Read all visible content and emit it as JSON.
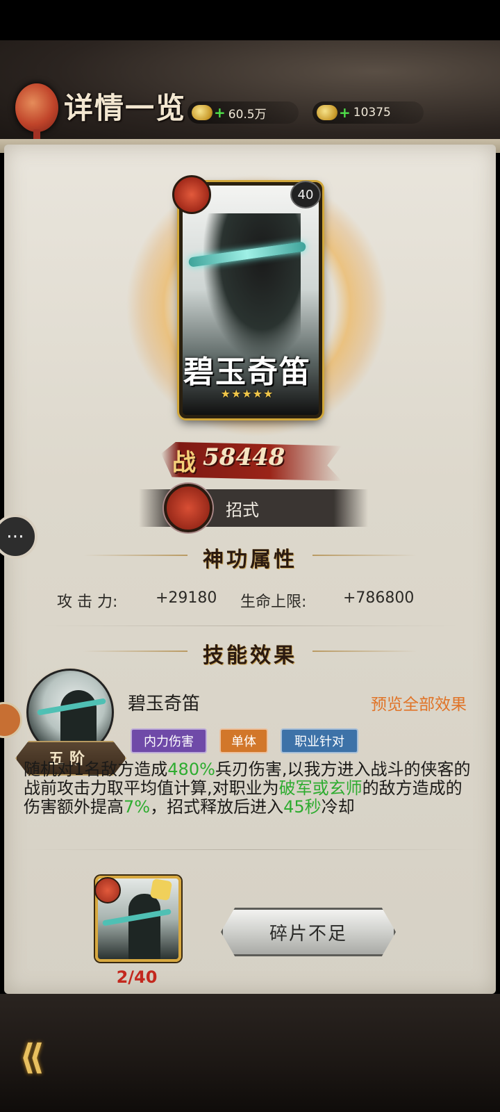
{
  "header": {
    "title": "详情一览",
    "currencies": [
      {
        "name": "coins",
        "value": "60.5万",
        "icon": "coin-icon"
      },
      {
        "name": "ingots",
        "value": "10375",
        "icon": "ingot-icon"
      }
    ]
  },
  "hero": {
    "name": "碧玉奇笛",
    "stars": "★★★★★",
    "level": "40",
    "power_label": "战",
    "power": "58448"
  },
  "moves_tab": {
    "label": "招式"
  },
  "divine_skill": {
    "title": "神功属性",
    "attrs": [
      {
        "label": "攻  击  力:",
        "value": "+29180"
      },
      {
        "label": "生命上限:",
        "value": "+786800"
      }
    ]
  },
  "skill_effect": {
    "title": "技能效果",
    "name": "碧玉奇笛",
    "preview_label": "预览全部效果",
    "rank": "五阶",
    "tags": [
      "内力伤害",
      "单体",
      "职业针对"
    ],
    "description": {
      "p1": "随机对1名敌方造成",
      "g1": "480%",
      "p2": "兵刃伤害,以我方进入战斗的侠客的战前攻击力取平均值计算,对职业为",
      "g2": "破军或玄师",
      "p3": "的敌方造成的伤害额外提高",
      "g3": "7%",
      "p4": "，招式释放后进入",
      "g4": "45秒",
      "p5": "冷却"
    }
  },
  "fragment": {
    "count": "2/40",
    "button_label": "碎片不足"
  },
  "colors": {
    "accent_green": "#2eac30",
    "accent_orange": "#e07428",
    "alert_red": "#c3281e"
  }
}
